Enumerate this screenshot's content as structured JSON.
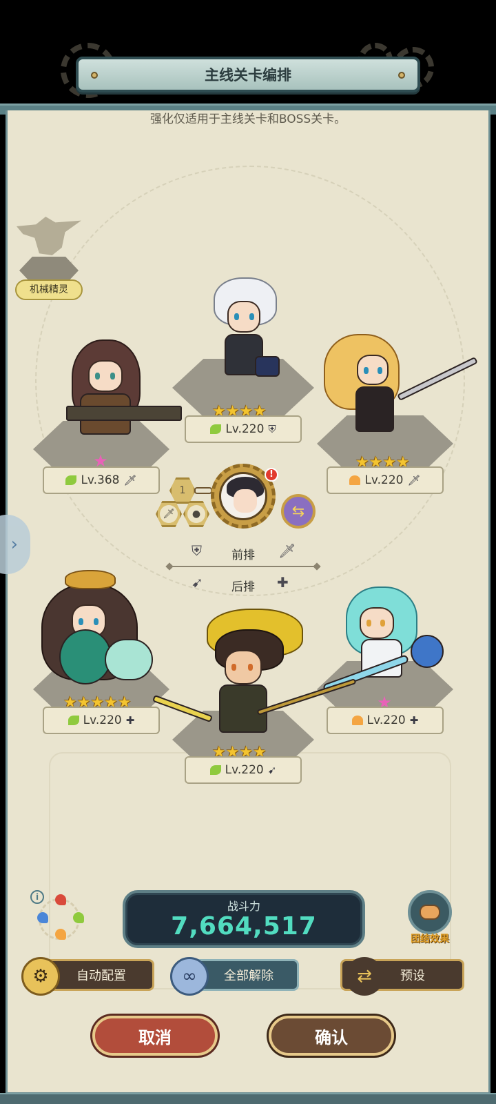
{
  "title": "主线关卡编排",
  "subtitle": "强化仅适用于主线关卡和BOSS关卡。",
  "pet": {
    "label": "机械精灵"
  },
  "heroes": {
    "mid_top": {
      "stars": "★★★★",
      "level": "Lv.220",
      "element": "leaf",
      "role_icon": "shield-icon",
      "role_glyph": "⛨"
    },
    "left_top": {
      "level": "Lv.368",
      "element": "leaf",
      "role_icon": "sword-icon",
      "role_glyph": "🗡",
      "pink_star": "★"
    },
    "right_top": {
      "stars": "★★★★",
      "level": "Lv.220",
      "element": "fire",
      "role_icon": "sword-icon",
      "role_glyph": "🗡"
    },
    "left_bot": {
      "stars": "★★★★★",
      "level": "Lv.220",
      "element": "leaf",
      "role_icon": "heal-icon",
      "role_glyph": "✚"
    },
    "right_bot": {
      "level": "Lv.220",
      "element": "fire",
      "role_icon": "heal-icon",
      "role_glyph": "✚",
      "pink_star": "★"
    },
    "mid_bot": {
      "stars": "★★★★",
      "level": "Lv.220",
      "element": "leaf",
      "role_icon": "bow-icon",
      "role_glyph": "➹"
    }
  },
  "leader": {
    "badge": "!",
    "slot_number": "1"
  },
  "rows": {
    "front": {
      "label": "前排",
      "left_icon": "⛨",
      "right_icon": "🗡"
    },
    "back": {
      "label": "后排",
      "left_icon": "➹",
      "right_icon": "✚"
    }
  },
  "power": {
    "label": "战斗力",
    "value": "7,664,517"
  },
  "unity": {
    "label": "团结效果"
  },
  "buttons": {
    "auto": "自动配置",
    "clear": "全部解除",
    "preset": "预设",
    "cancel": "取消",
    "confirm": "确认"
  },
  "colors": {
    "panel": "#e9e4cf",
    "frame": "#5b8186",
    "power_value": "#52dcc0",
    "star": "#f3c430",
    "cancel": "#b24d3b",
    "confirm": "#6b4b34"
  }
}
